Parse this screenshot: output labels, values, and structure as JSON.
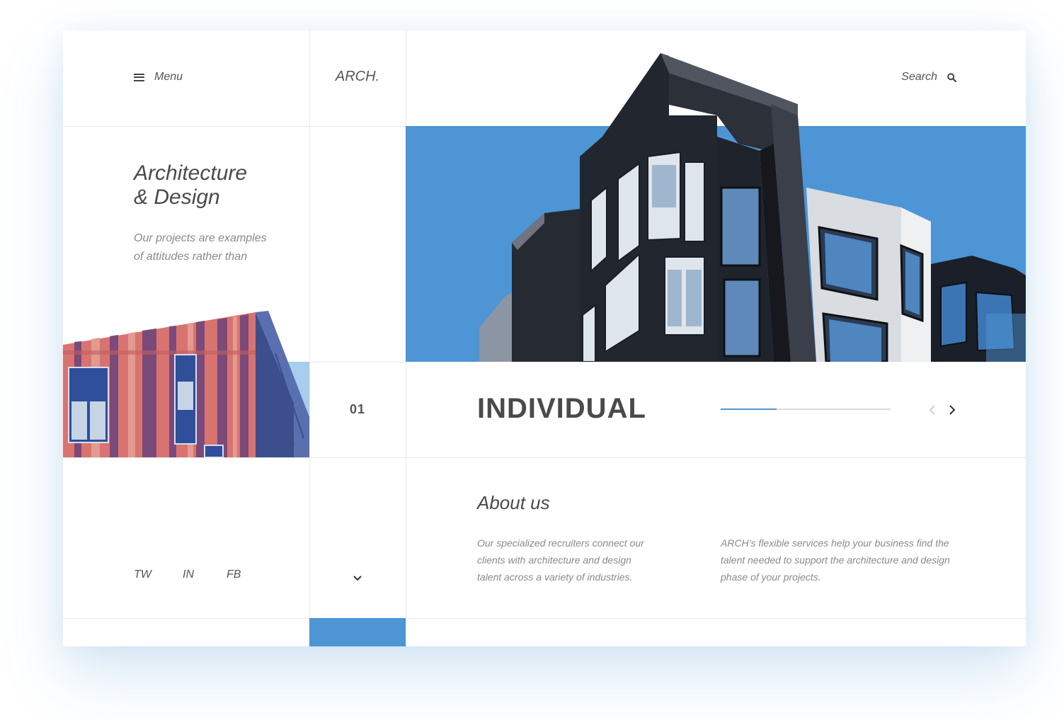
{
  "header": {
    "menu_label": "Menu",
    "logo": "ARCH.",
    "search_label": "Search"
  },
  "hero": {
    "headline_line1": "Architecture",
    "headline_line2": "& Design",
    "intro_line1": "Our projects are examples",
    "intro_line2": "of attitudes rather than"
  },
  "slider": {
    "counter": "01",
    "title": "INDIVIDUAL",
    "progress": 0.33
  },
  "about": {
    "title": "About us",
    "paragraph1": "Our specialized recruiters connect our clients with architecture and design talent across a variety of industries.",
    "paragraph2": "ARCH’s flexible services help your business find the talent needed to support the architecture and design phase of your projects."
  },
  "social": [
    "TW",
    "IN",
    "FB"
  ],
  "icons": {
    "menu": "hamburger-icon",
    "search": "search-icon",
    "prev": "chevron-left-icon",
    "next": "chevron-right-icon",
    "scroll": "chevron-down-icon"
  },
  "colors": {
    "accent": "#4d95d4",
    "accent_light": "#a7cdef",
    "text": "#4a4a4a",
    "muted": "#8a8a8a"
  }
}
